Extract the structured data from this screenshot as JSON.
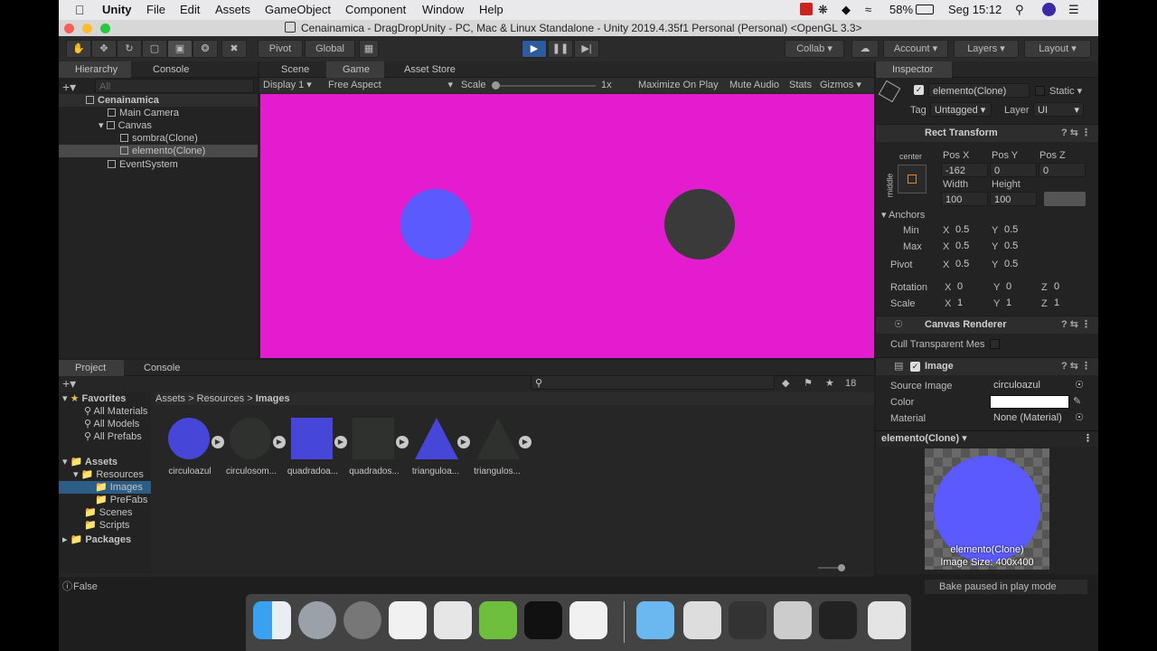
{
  "mac_menubar": {
    "app": "Unity",
    "items": [
      "File",
      "Edit",
      "Assets",
      "GameObject",
      "Component",
      "Window",
      "Help"
    ],
    "battery": "58%",
    "clock": "Seg 15:12"
  },
  "window": {
    "title": "Cenainamica - DragDropUnity - PC, Mac & Linux Standalone - Unity 2019.4.35f1 Personal (Personal) <OpenGL 3.3>"
  },
  "toolbar": {
    "pivot": "Pivot",
    "global": "Global",
    "collab": "Collab",
    "account": "Account",
    "layers": "Layers",
    "layout": "Layout"
  },
  "hierarchy": {
    "tabs": [
      "Hierarchy",
      "Console"
    ],
    "search_placeholder": "All",
    "scene": "Cenainamica",
    "items": [
      "Main Camera",
      "Canvas",
      "sombra(Clone)",
      "elemento(Clone)",
      "EventSystem"
    ]
  },
  "game_view": {
    "tabs": [
      "Scene",
      "Game",
      "Asset Store"
    ],
    "display": "Display 1",
    "aspect": "Free Aspect",
    "scale_label": "Scale",
    "scale_value": "1x",
    "options": [
      "Maximize On Play",
      "Mute Audio",
      "Stats",
      "Gizmos"
    ],
    "background_color": "#e31cd0",
    "blue_circle_color": "#5a5aff",
    "dark_circle_color": "#3a3a3a"
  },
  "project": {
    "tabs": [
      "Project",
      "Console"
    ],
    "count": "18",
    "favorites_label": "Favorites",
    "favorites": [
      "All Materials",
      "All Models",
      "All Prefabs"
    ],
    "assets_label": "Assets",
    "tree": [
      "Resources",
      "Images",
      "PreFabs",
      "Scenes",
      "Scripts"
    ],
    "packages_label": "Packages",
    "breadcrumb": [
      "Assets",
      "Resources",
      "Images"
    ],
    "assets": [
      {
        "name": "circuloazul",
        "shape": "circle",
        "color": "#4646d8"
      },
      {
        "name": "circulosom...",
        "shape": "circle",
        "color": "#2e312e"
      },
      {
        "name": "quadradoa...",
        "shape": "square",
        "color": "#4646d8"
      },
      {
        "name": "quadrados...",
        "shape": "square",
        "color": "#2e312e"
      },
      {
        "name": "trianguloa...",
        "shape": "triangle",
        "color": "#4646d8"
      },
      {
        "name": "triangulos...",
        "shape": "triangle",
        "color": "#2e312e"
      }
    ]
  },
  "inspector": {
    "tab": "Inspector",
    "object_name": "elemento(Clone)",
    "static_label": "Static",
    "tag_label": "Tag",
    "tag_value": "Untagged",
    "layer_label": "Layer",
    "layer_value": "UI",
    "rect_transform": "Rect Transform",
    "anchor_preset_h": "center",
    "anchor_preset_v": "middle",
    "pos_labels": [
      "Pos X",
      "Pos Y",
      "Pos Z"
    ],
    "pos_values": [
      "-162",
      "0",
      "0"
    ],
    "size_labels": [
      "Width",
      "Height"
    ],
    "size_values": [
      "100",
      "100"
    ],
    "anchors_label": "Anchors",
    "min_label": "Min",
    "min_x": "0.5",
    "min_y": "0.5",
    "max_label": "Max",
    "max_x": "0.5",
    "max_y": "0.5",
    "pivot_label": "Pivot",
    "pivot_x": "0.5",
    "pivot_y": "0.5",
    "rotation_label": "Rotation",
    "rotation": [
      "0",
      "0",
      "0"
    ],
    "scale_label": "Scale",
    "scale": [
      "1",
      "1",
      "1"
    ],
    "canvas_renderer": "Canvas Renderer",
    "cull_label": "Cull Transparent Mes",
    "image_component": "Image",
    "source_image_label": "Source Image",
    "source_image_value": "circuloazul",
    "color_label": "Color",
    "material_label": "Material",
    "material_value": "None (Material)",
    "preview_title": "elemento(Clone)",
    "preview_name": "elemento(Clone)",
    "preview_size": "Image Size: 400x400"
  },
  "statusbar": {
    "left": "False",
    "right": "Bake paused in play mode"
  }
}
